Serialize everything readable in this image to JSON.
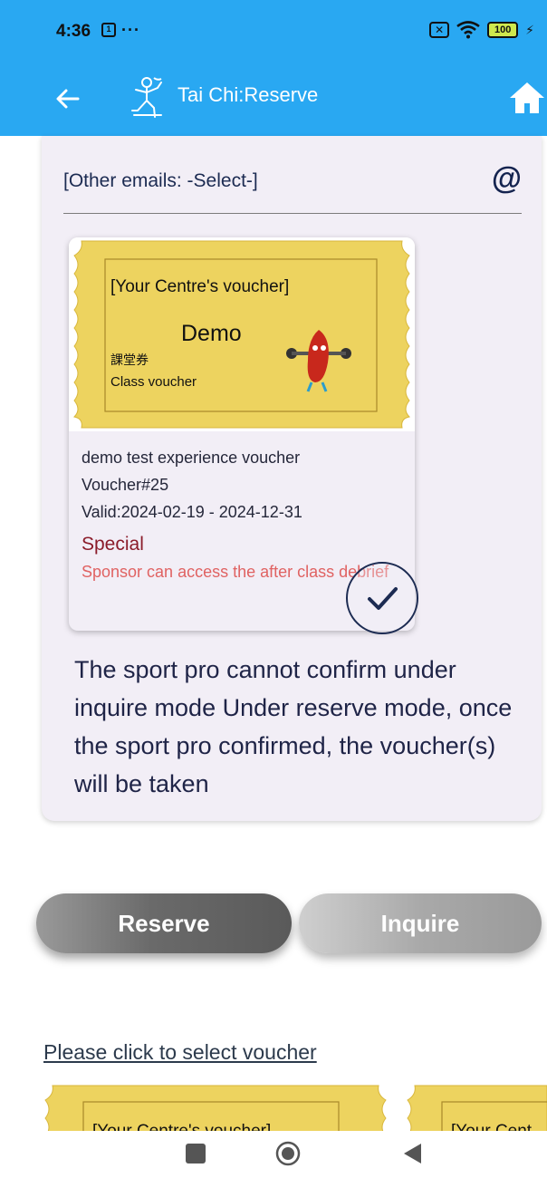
{
  "status_bar": {
    "time": "4:36",
    "notification_dots": "···",
    "battery": "100"
  },
  "app_bar": {
    "title": "Tai Chi:Reserve",
    "color": "#29a8f2"
  },
  "email_select": {
    "label": "[Other emails: -Select-]",
    "icon": "@"
  },
  "voucher": {
    "image_heading": "[Your Centre's voucher]",
    "image_title": "Demo",
    "image_chinese": "課堂券",
    "image_subtitle": "Class voucher",
    "name": "demo test experience voucher",
    "number": "Voucher#25",
    "valid": "Valid:2024-02-19 - 2024-12-31",
    "special_label": "Special",
    "description": "Sponsor can access the after class debrief",
    "selected": true
  },
  "notice": "The sport pro cannot confirm under inquire mode Under reserve mode, once the sport pro confirmed, the voucher(s) will be taken",
  "buttons": {
    "reserve": "Reserve",
    "inquire": "Inquire"
  },
  "select_voucher_link": "Please click to select voucher",
  "mini_vouchers": [
    {
      "heading": "[Your Centre's voucher]"
    },
    {
      "heading": "[Your Cent"
    }
  ],
  "colors": {
    "accent": "#29a8f2",
    "card_bg": "#f2eef6",
    "voucher_gold": "#edd35f",
    "special": "#8b1c2a",
    "description": "#e06262"
  }
}
